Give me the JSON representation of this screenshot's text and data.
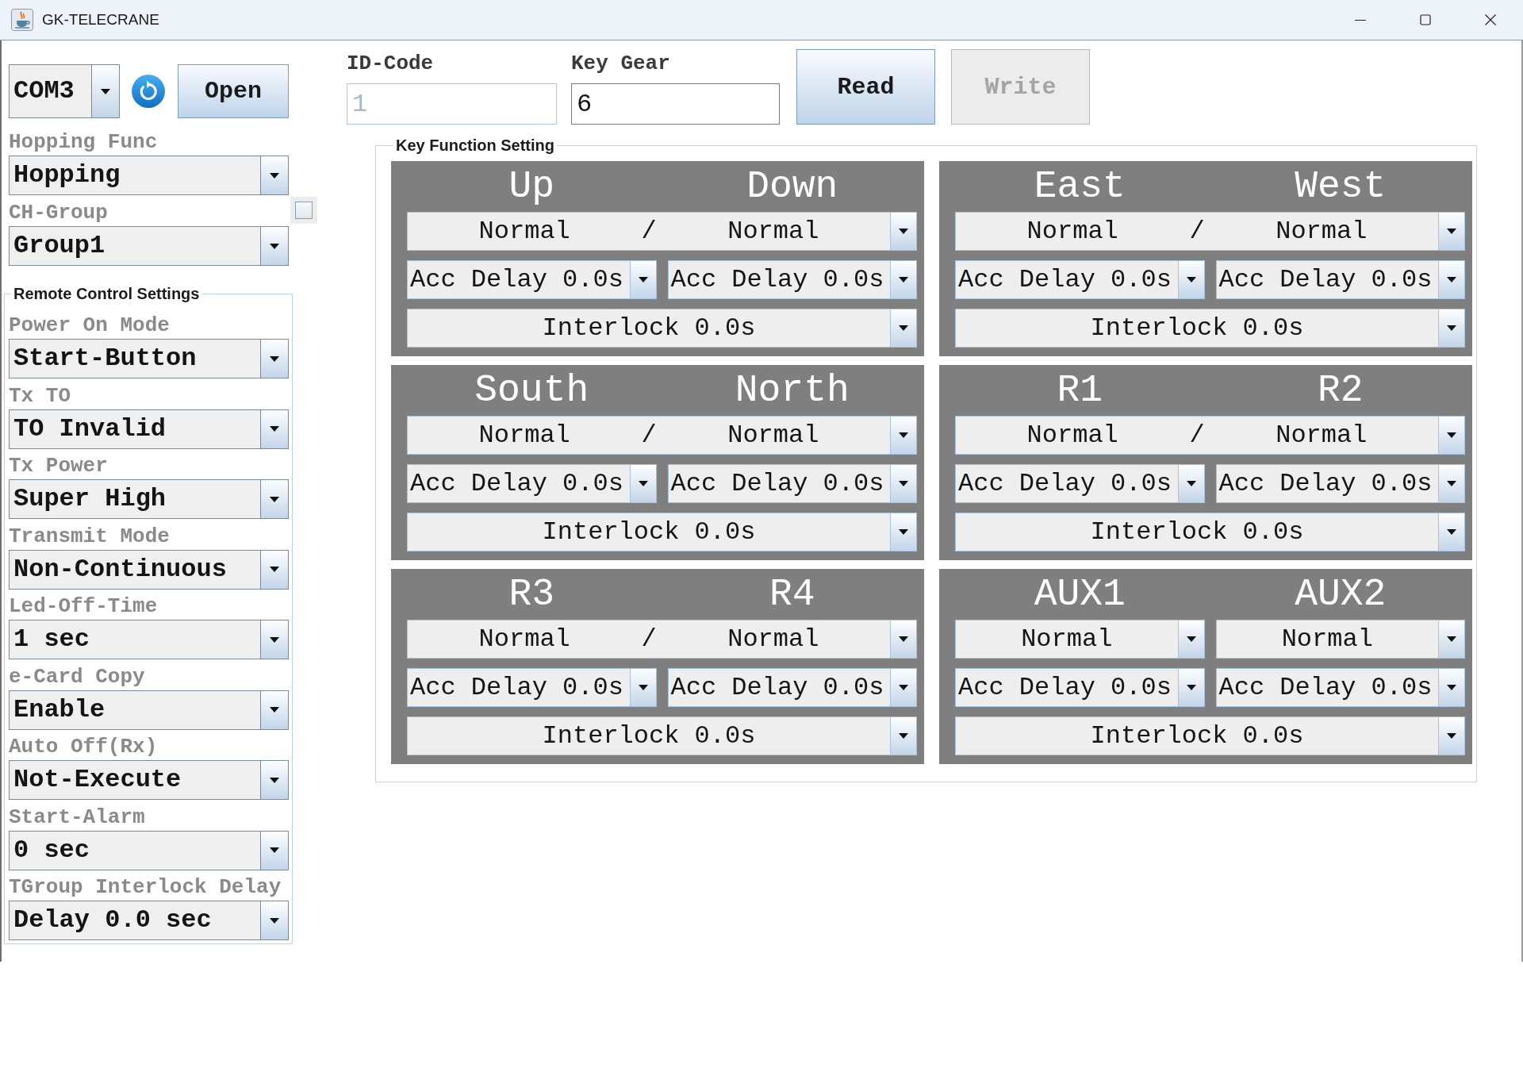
{
  "window": {
    "title": "GK-TELECRANE"
  },
  "port": {
    "value": "COM3"
  },
  "open_button": {
    "label": "Open"
  },
  "hopping_func": {
    "label": "Hopping Func",
    "value": "Hopping"
  },
  "ch_group": {
    "label": "CH-Group",
    "value": "Group1",
    "checked": false
  },
  "remote_control_settings": {
    "title": "Remote Control Settings",
    "fields": [
      {
        "label": "Power On Mode",
        "value": "Start-Button"
      },
      {
        "label": "Tx TO",
        "value": "TO Invalid"
      },
      {
        "label": "Tx Power",
        "value": "Super High"
      },
      {
        "label": "Transmit Mode",
        "value": "Non-Continuous"
      },
      {
        "label": "Led-Off-Time",
        "value": "1 sec"
      },
      {
        "label": "e-Card Copy",
        "value": "Enable"
      },
      {
        "label": "Auto Off(Rx)",
        "value": "Not-Execute"
      },
      {
        "label": "Start-Alarm",
        "value": "0 sec"
      },
      {
        "label": "TGroup Interlock Delay",
        "value": "Delay 0.0 sec"
      }
    ]
  },
  "id_code": {
    "label": "ID-Code",
    "value": "1",
    "disabled": true
  },
  "key_gear": {
    "label": "Key Gear",
    "value": "6",
    "disabled": false
  },
  "actions": [
    {
      "label": "Read",
      "disabled": false
    },
    {
      "label": "Write",
      "disabled": true
    }
  ],
  "key_function_setting": {
    "title": "Key Function Setting",
    "panels": [
      {
        "keys": [
          "Up",
          "Down"
        ],
        "mode": {
          "kind": "shared",
          "values": [
            "Normal",
            "Normal"
          ],
          "separator": "/"
        },
        "acc_delays": [
          "Acc Delay 0.0s",
          "Acc Delay 0.0s"
        ],
        "interlock": "Interlock 0.0s"
      },
      {
        "keys": [
          "East",
          "West"
        ],
        "mode": {
          "kind": "shared",
          "values": [
            "Normal",
            "Normal"
          ],
          "separator": "/"
        },
        "acc_delays": [
          "Acc Delay 0.0s",
          "Acc Delay 0.0s"
        ],
        "interlock": "Interlock 0.0s"
      },
      {
        "keys": [
          "South",
          "North"
        ],
        "mode": {
          "kind": "shared",
          "values": [
            "Normal",
            "Normal"
          ],
          "separator": "/"
        },
        "acc_delays": [
          "Acc Delay 0.0s",
          "Acc Delay 0.0s"
        ],
        "interlock": "Interlock 0.0s"
      },
      {
        "keys": [
          "R1",
          "R2"
        ],
        "mode": {
          "kind": "shared",
          "values": [
            "Normal",
            "Normal"
          ],
          "separator": "/"
        },
        "acc_delays": [
          "Acc Delay 0.0s",
          "Acc Delay 0.0s"
        ],
        "interlock": "Interlock 0.0s"
      },
      {
        "keys": [
          "R3",
          "R4"
        ],
        "mode": {
          "kind": "shared",
          "values": [
            "Normal",
            "Normal"
          ],
          "separator": "/"
        },
        "acc_delays": [
          "Acc Delay 0.0s",
          "Acc Delay 0.0s"
        ],
        "interlock": "Interlock 0.0s"
      },
      {
        "keys": [
          "AUX1",
          "AUX2"
        ],
        "mode": {
          "kind": "split",
          "values": [
            "Normal",
            "Normal"
          ]
        },
        "acc_delays": [
          "Acc Delay 0.0s",
          "Acc Delay 0.0s"
        ],
        "interlock": "Interlock 0.0s"
      }
    ]
  }
}
